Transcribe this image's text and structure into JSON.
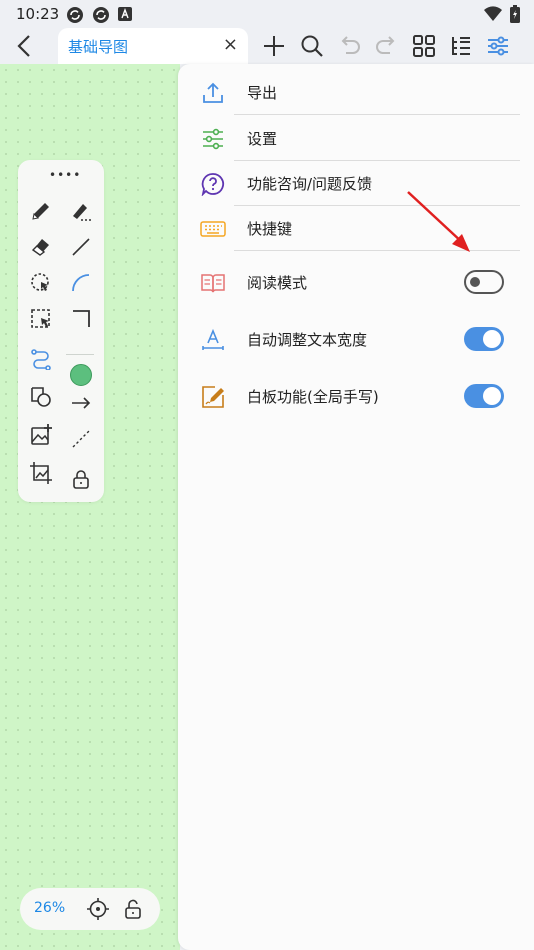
{
  "status_bar": {
    "time": "10:23",
    "icons": [
      "sync-icon",
      "sync-icon",
      "font-a-icon",
      "wifi-icon",
      "battery-icon"
    ]
  },
  "toolbar": {
    "tab_label": "基础导图",
    "tab_close": "×",
    "buttons": [
      "plus-icon",
      "search-icon",
      "undo-icon",
      "redo-icon",
      "grid-icon",
      "outline-icon",
      "settings-sliders-icon"
    ]
  },
  "canvas": {
    "background_color": "#cff5c7",
    "tools": [
      "pen-icon",
      "marker-icon",
      "eraser-icon",
      "line-icon",
      "lasso-icon",
      "arc-icon",
      "select-box-icon",
      "corner-icon",
      "connector-icon",
      "color-swatch",
      "shapes-icon",
      "arrow-icon",
      "image-add-icon",
      "dashed-line-icon",
      "crop-image-icon",
      "lock-icon"
    ],
    "swatch_color": "#5cbf7e",
    "zoom": "26%"
  },
  "menu": {
    "items": [
      {
        "label": "导出",
        "icon": "export-icon"
      },
      {
        "label": "设置",
        "icon": "settings-icon"
      },
      {
        "label": "功能咨询/问题反馈",
        "icon": "help-icon"
      },
      {
        "label": "快捷键",
        "icon": "keyboard-icon"
      },
      {
        "label": "阅读模式",
        "icon": "book-icon",
        "toggle": false
      },
      {
        "label": "自动调整文本宽度",
        "icon": "text-width-icon",
        "toggle": true
      },
      {
        "label": "白板功能(全局手写)",
        "icon": "whiteboard-icon",
        "toggle": true
      }
    ]
  },
  "colors": {
    "accent": "#1e88e5",
    "toggle_on": "#4a90e2",
    "annotation_arrow": "#e02020"
  }
}
